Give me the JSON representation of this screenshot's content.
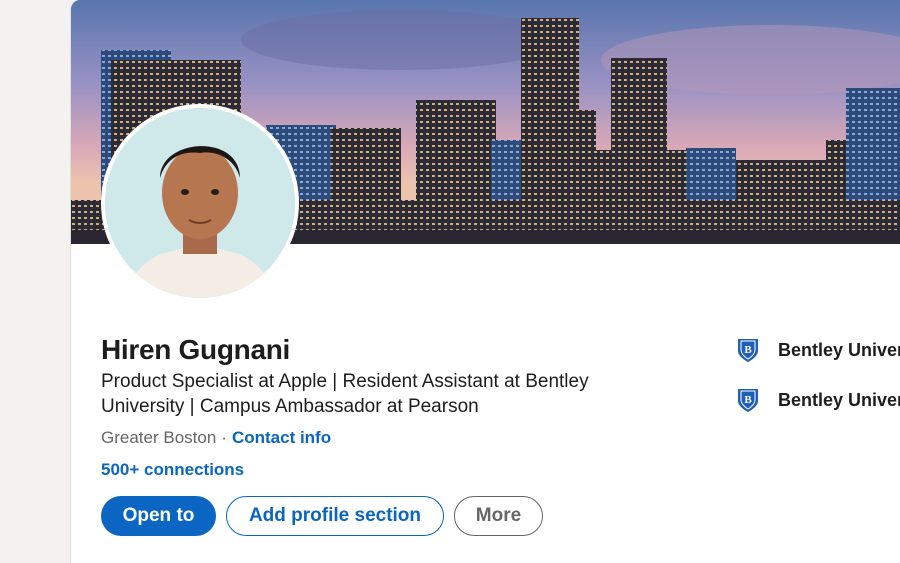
{
  "profile": {
    "name": "Hiren Gugnani",
    "headline": "Product Specialist at Apple | Resident Assistant at Bentley University | Campus Ambassador at Pearson",
    "location": "Greater Boston",
    "separator": "·",
    "contact_info_label": "Contact info",
    "connections_label": "500+ connections"
  },
  "actions": {
    "open_to_label": "Open to",
    "add_section_label": "Add profile section",
    "more_label": "More"
  },
  "education": [
    {
      "school": "Bentley University",
      "icon": "bentley-shield-icon"
    },
    {
      "school": "Bentley University",
      "icon": "bentley-shield-icon"
    }
  ],
  "colors": {
    "accent": "#0a66c2",
    "text_primary": "#1d1d1d",
    "text_secondary": "#666666",
    "page_background": "#f3f2ef"
  },
  "icons": {
    "banner": "city-skyline-banner",
    "avatar": "profile-photo"
  }
}
